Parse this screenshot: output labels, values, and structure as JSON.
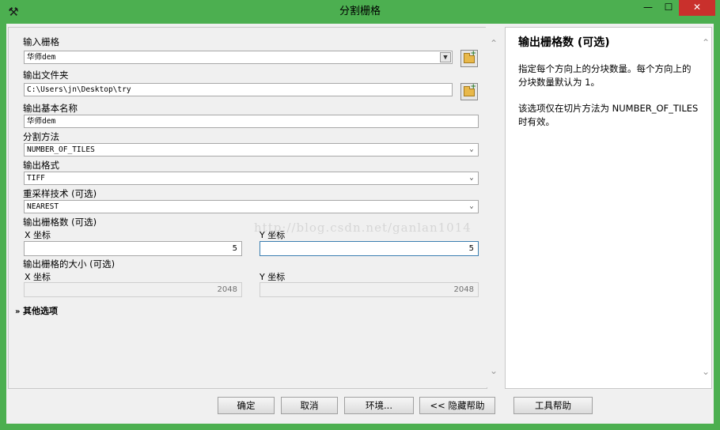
{
  "window": {
    "title": "分割栅格",
    "minimize": "—",
    "maximize": "☐",
    "close": "✕",
    "app_icon": "hammer-icon"
  },
  "form": {
    "input_raster": {
      "label": "输入栅格",
      "value": "华师dem"
    },
    "output_folder": {
      "label": "输出文件夹",
      "value": "C:\\Users\\jn\\Desktop\\try"
    },
    "output_base_name": {
      "label": "输出基本名称",
      "value": "华师dem"
    },
    "split_method": {
      "label": "分割方法",
      "value": "NUMBER_OF_TILES"
    },
    "output_format": {
      "label": "输出格式",
      "value": "TIFF"
    },
    "resampling": {
      "label": "重采样技术 (可选)",
      "value": "NEAREST"
    },
    "num_rasters": {
      "label": "输出栅格数 (可选)",
      "x_label": "X 坐标",
      "x_value": "5",
      "y_label": "Y 坐标",
      "y_value": "5"
    },
    "tile_size": {
      "label": "输出栅格的大小 (可选)",
      "x_label": "X 坐标",
      "x_value": "2048",
      "y_label": "Y 坐标",
      "y_value": "2048"
    },
    "other_options": "其他选项"
  },
  "watermark": "http://blog.csdn.net/ganlan1014",
  "help": {
    "title": "输出栅格数 (可选)",
    "para1": "指定每个方向上的分块数量。每个方向上的分块数量默认为 1。",
    "para2": "该选项仅在切片方法为 NUMBER_OF_TILES 时有效。"
  },
  "buttons": {
    "ok": "确定",
    "cancel": "取消",
    "env": "环境...",
    "hide_help": "<< 隐藏帮助",
    "tool_help": "工具帮助"
  }
}
